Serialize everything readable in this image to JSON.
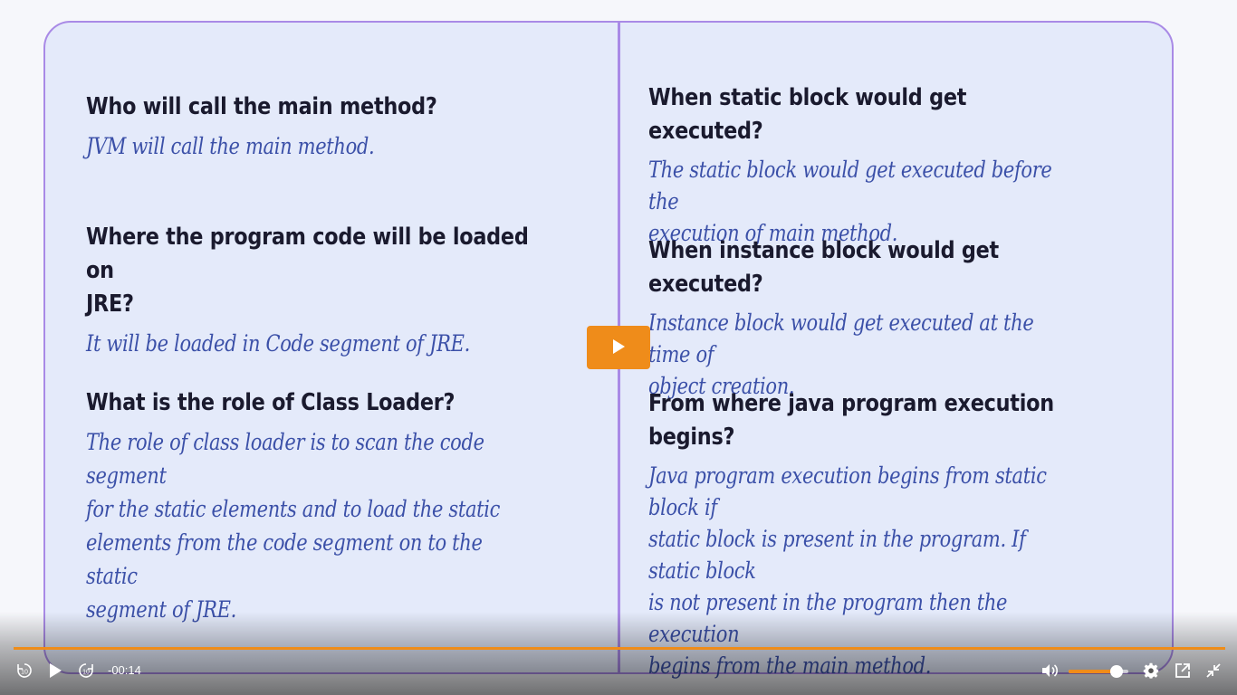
{
  "slide": {
    "left_column": [
      {
        "question": "Who will call the main method?",
        "answer": "JVM will call the main method."
      },
      {
        "question": "Where the program code will be loaded on\nJRE?",
        "answer": "It will be loaded in Code segment of JRE."
      },
      {
        "question": "What is the role of Class Loader?",
        "answer": "The role of class loader is to scan the code segment\nfor the static elements and to load  the static\nelements from the code segment on to the static\nsegment of JRE."
      }
    ],
    "right_column": [
      {
        "question": "When static block would get executed?",
        "answer": "The static block would get executed before the\nexecution of main method."
      },
      {
        "question": "When instance block would get executed?",
        "answer": "Instance block would get executed at the time of\nobject creation."
      },
      {
        "question": "From where java program execution begins?",
        "answer": "Java program execution begins from static block if\nstatic block is present in the program. If static block\nis not present in the program then the execution\nbegins from the main method."
      }
    ]
  },
  "player": {
    "time_remaining": "-00:14",
    "progress_fraction": 1.0,
    "volume_fraction": 0.8,
    "accent_color": "#ef8c1a",
    "icons": {
      "big_play": "play-icon",
      "rewind": "rewind-10-icon",
      "play": "play-icon",
      "forward": "forward-10-icon",
      "volume": "volume-icon",
      "settings": "gear-icon",
      "popout": "external-link-icon",
      "exit_fullscreen": "exit-fullscreen-icon"
    }
  }
}
